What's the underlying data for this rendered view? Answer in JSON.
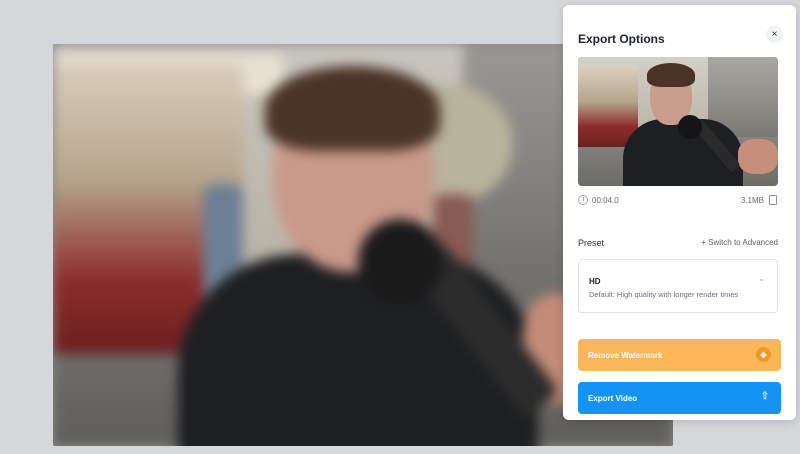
{
  "panel": {
    "title": "Export Options",
    "close_glyph": "×"
  },
  "media": {
    "duration": "00:04.0",
    "file_size": "3.1MB"
  },
  "preset": {
    "label": "Preset",
    "switch_link": "+ Switch to Advanced",
    "selected_name": "HD",
    "selected_description": "Default: High quality with longer render times"
  },
  "buttons": {
    "remove_watermark": "Remove Watermark",
    "export_video": "Export Video"
  },
  "icons": {
    "close": "close-icon",
    "clock": "clock-icon",
    "file": "file-icon",
    "chevron": "chevron-down-icon",
    "diamond": "diamond-icon",
    "upload": "upload-icon"
  },
  "colors": {
    "watermark_button": "#fbb65a",
    "export_button": "#1493f5",
    "badge": "#f29a1f"
  }
}
